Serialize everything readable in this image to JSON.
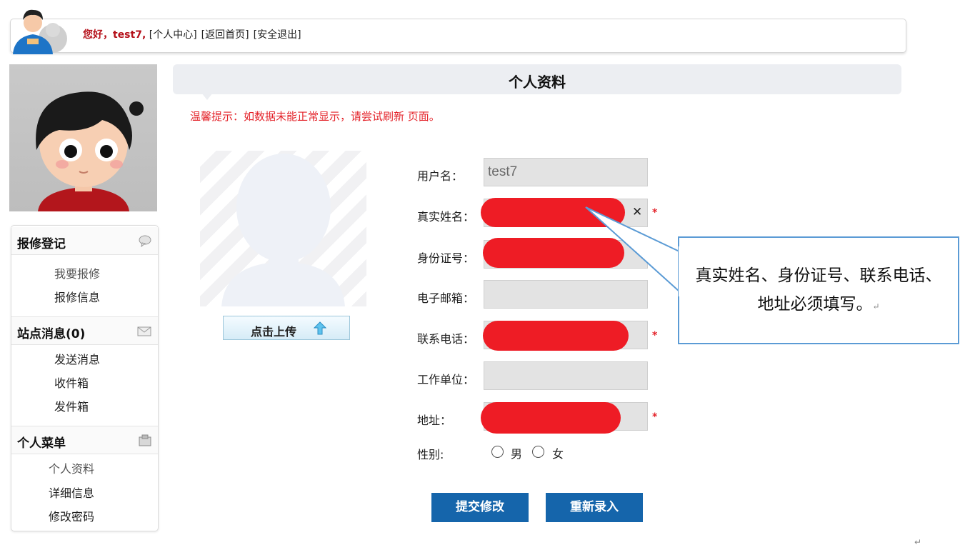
{
  "header": {
    "greeting": "您好，test7,",
    "links": [
      "[个人中心]",
      "[返回首页]",
      "[安全退出]"
    ]
  },
  "sidebar": {
    "sections": [
      {
        "title": "报修登记",
        "icon": "chat-bubble-icon",
        "items": [
          "我要报修",
          "报修信息"
        ]
      },
      {
        "title": "站点消息(0)",
        "icon": "mail-icon",
        "items": [
          "发送消息",
          "收件箱",
          "发件箱"
        ]
      },
      {
        "title": "个人菜单",
        "icon": "box-icon",
        "items": [
          "个人资料",
          "详细信息",
          "修改密码"
        ]
      }
    ]
  },
  "main": {
    "title": "个人资料",
    "tip": "温馨提示：如数据未能正常显示，请尝试刷新 页面。",
    "upload_label": "点击上传",
    "fields": {
      "username": {
        "label": "用户名：",
        "value": "test7"
      },
      "realname": {
        "label": "真实姓名：",
        "required": "*",
        "clear": "✕"
      },
      "idcard": {
        "label": "身份证号："
      },
      "email": {
        "label": "电子邮箱："
      },
      "phone": {
        "label": "联系电话：",
        "required": "*"
      },
      "company": {
        "label": "工作单位："
      },
      "address": {
        "label": "地址：",
        "required": "*"
      },
      "gender": {
        "label": "性别:",
        "options": [
          "男",
          "女"
        ]
      }
    },
    "buttons": {
      "submit": "提交修改",
      "reset": "重新录入"
    }
  },
  "callout": {
    "text": "真实姓名、身份证号、联系电话、地址必须填写。",
    "mark": "↵"
  },
  "colors": {
    "accent": "#1565ab",
    "required": "#e4242b",
    "redaction": "#ee1c25",
    "callout_border": "#5b9bd5"
  }
}
